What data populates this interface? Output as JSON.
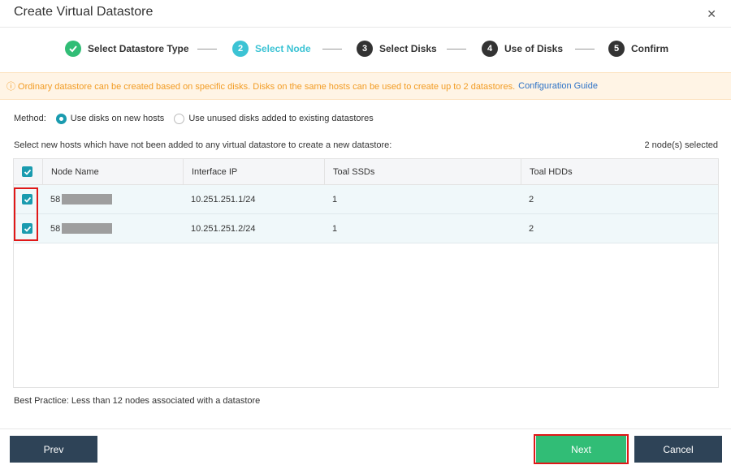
{
  "window": {
    "title": "Create Virtual Datastore"
  },
  "steps": [
    {
      "number": "✓",
      "label": "Select Datastore Type",
      "state": "done",
      "color": "#31bd76"
    },
    {
      "number": "2",
      "label": "Select Node",
      "state": "active",
      "color": "#3cc3d4"
    },
    {
      "number": "3",
      "label": "Select Disks",
      "state": "pending",
      "color": "#333333"
    },
    {
      "number": "4",
      "label": "Use of Disks",
      "state": "pending",
      "color": "#333333"
    },
    {
      "number": "5",
      "label": "Confirm",
      "state": "pending",
      "color": "#333333"
    }
  ],
  "banner": {
    "icon": "info-circle-icon",
    "text": "ⓘ  Ordinary datastore can be created based on specific disks. Disks on the same hosts can be used to create up to 2 datastores.",
    "link": "Configuration Guide"
  },
  "method": {
    "label": "Method:",
    "options": [
      {
        "label": "Use disks on new hosts",
        "selected": true
      },
      {
        "label": "Use unused disks added to existing datastores",
        "selected": false
      }
    ]
  },
  "instruction": "Select new hosts which have not been added to any virtual datastore to create a new datastore:",
  "selected_count": "2 node(s) selected",
  "table": {
    "columns": [
      "Node Name",
      "Interface IP",
      "Toal SSDs",
      "Toal HDDs"
    ],
    "rows": [
      {
        "checked": true,
        "node_name": "58",
        "interface_ip": "10.251.251.1/24",
        "ssds": "1",
        "hdds": "2"
      },
      {
        "checked": true,
        "node_name": "58",
        "interface_ip": "10.251.251.2/24",
        "ssds": "1",
        "hdds": "2"
      }
    ]
  },
  "best_practice": "Best Practice: Less than 12 nodes associated with a datastore",
  "footer": {
    "prev": "Prev",
    "next": "Next",
    "cancel": "Cancel"
  },
  "colors": {
    "accent": "#1a9baf",
    "primary": "#31bd76",
    "dark": "#2e4357",
    "warning": "#f29c24",
    "link": "#2d72c6"
  }
}
